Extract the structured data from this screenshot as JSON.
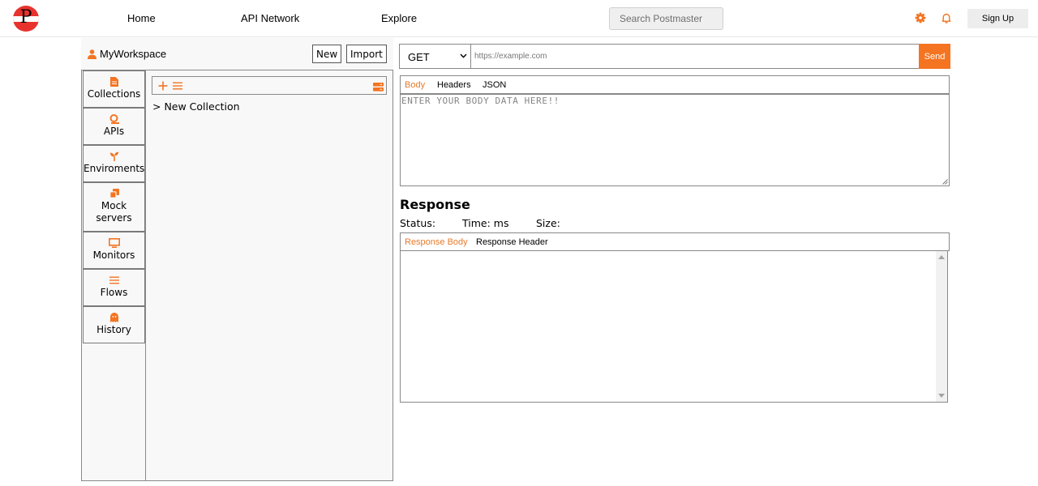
{
  "brand": {
    "letter": "P"
  },
  "nav": {
    "links": [
      "Home",
      "API Network",
      "Explore"
    ],
    "search_placeholder": "Search Postmaster",
    "sign_up_label": "Sign Up"
  },
  "workspace": {
    "name": "MyWorkspace",
    "new_label": "New",
    "import_label": "Import"
  },
  "sidebar": {
    "items": [
      {
        "label": "Collections",
        "icon": "file-icon"
      },
      {
        "label": "APIs",
        "icon": "api-icon"
      },
      {
        "label": "Enviroments",
        "icon": "sprout-icon"
      },
      {
        "label": "Mock servers",
        "icon": "copy-icon"
      },
      {
        "label": "Monitors",
        "icon": "monitor-icon"
      },
      {
        "label": "Flows",
        "icon": "flows-icon"
      },
      {
        "label": "History",
        "icon": "ghost-icon"
      }
    ]
  },
  "collections": {
    "items": [
      "> New Collection"
    ]
  },
  "request": {
    "method": "GET",
    "url_placeholder": "https://example.com",
    "send_label": "Send",
    "tabs": [
      "Body",
      "Headers",
      "JSON"
    ],
    "active_tab": "Body",
    "body_placeholder": "ENTER YOUR BODY DATA HERE!!"
  },
  "response": {
    "title": "Response",
    "status_label": "Status:",
    "time_label": "Time: ms",
    "size_label": "Size:",
    "tabs": [
      "Response Body",
      "Response Header"
    ],
    "active_tab": "Response Body"
  },
  "colors": {
    "accent": "#f47421",
    "logo": "#e8322d"
  }
}
